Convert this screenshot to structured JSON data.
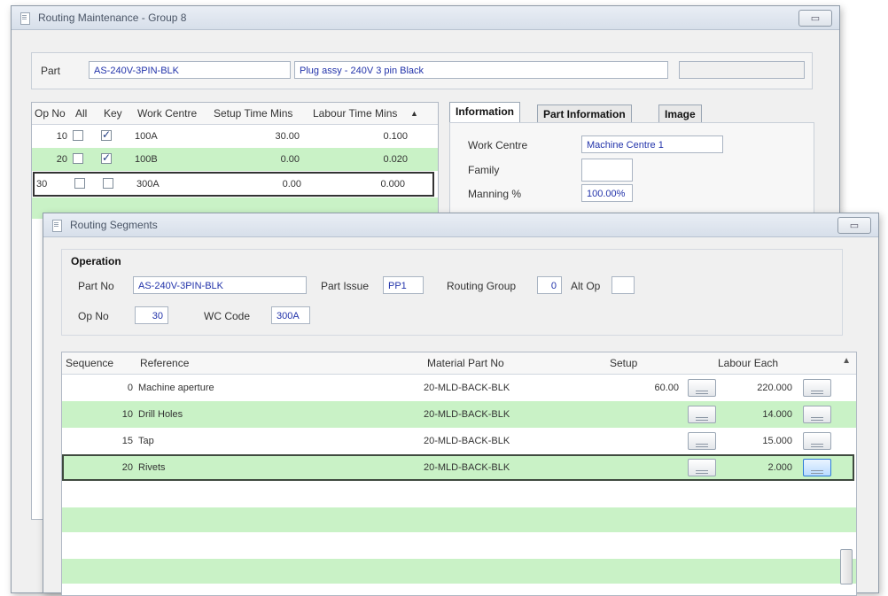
{
  "back_window": {
    "title": "Routing Maintenance - Group 8",
    "part_label": "Part",
    "part_no": "AS-240V-3PIN-BLK",
    "part_desc": "Plug assy - 240V 3 pin Black",
    "ops_columns": [
      "Op No",
      "All",
      "Key",
      "Work Centre",
      "Setup Time Mins",
      "Labour Time Mins"
    ],
    "ops_rows": [
      {
        "op": "10",
        "all": false,
        "key": true,
        "wc": "100A",
        "setup": "30.00",
        "labour": "0.100"
      },
      {
        "op": "20",
        "all": false,
        "key": true,
        "wc": "100B",
        "setup": "0.00",
        "labour": "0.020"
      },
      {
        "op": "30",
        "all": false,
        "key": false,
        "wc": "300A",
        "setup": "0.00",
        "labour": "0.000"
      }
    ],
    "tabs": [
      "Information",
      "Part Information",
      "Image"
    ],
    "info_labels": {
      "work_centre": "Work Centre",
      "family": "Family",
      "manning": "Manning %"
    },
    "info_values": {
      "work_centre": "Machine Centre 1",
      "manning": "100.00%"
    }
  },
  "front_window": {
    "title": "Routing Segments",
    "operation_label": "Operation",
    "part_no_label": "Part No",
    "part_no": "AS-240V-3PIN-BLK",
    "part_issue_label": "Part Issue",
    "part_issue": "PP1",
    "routing_group_label": "Routing Group",
    "routing_group": "0",
    "alt_op_label": "Alt Op",
    "alt_op": "",
    "op_no_label": "Op No",
    "op_no": "30",
    "wc_code_label": "WC Code",
    "wc_code": "300A",
    "seg_columns": [
      "Sequence",
      "Reference",
      "Material Part No",
      "Setup",
      "Labour Each"
    ],
    "seg_rows": [
      {
        "seq": "0",
        "ref": "Machine aperture",
        "mat": "20-MLD-BACK-BLK",
        "setup": "60.00",
        "labour": "220.000"
      },
      {
        "seq": "10",
        "ref": "Drill Holes",
        "mat": "20-MLD-BACK-BLK",
        "setup": "",
        "labour": "14.000"
      },
      {
        "seq": "15",
        "ref": "Tap",
        "mat": "20-MLD-BACK-BLK",
        "setup": "",
        "labour": "15.000"
      },
      {
        "seq": "20",
        "ref": "Rivets",
        "mat": "20-MLD-BACK-BLK",
        "setup": "",
        "labour": "2.000"
      }
    ]
  },
  "colors": {
    "row_green": "#c9f2c6",
    "field_text": "#2233aa"
  }
}
